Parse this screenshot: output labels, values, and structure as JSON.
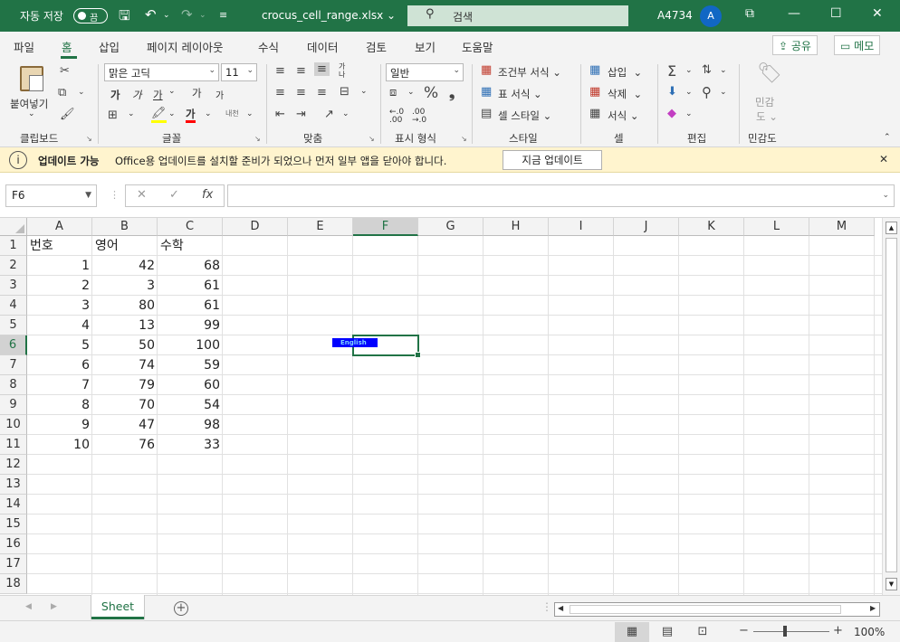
{
  "titlebar": {
    "autosave_label": "자동 저장",
    "autosave_state": "끔",
    "filename": "crocus_cell_range.xlsx",
    "filename_caret": "⌄",
    "search_placeholder": "검색",
    "user": "A4734",
    "avatar_initial": "A"
  },
  "tabs": [
    "파일",
    "홈",
    "삽입",
    "페이지 레이아웃",
    "수식",
    "데이터",
    "검토",
    "보기",
    "도움말"
  ],
  "active_tab": "홈",
  "share_label": "공유",
  "memo_label": "메모",
  "ribbon": {
    "clipboard": {
      "paste": "붙여넣기",
      "label": "클립보드"
    },
    "font": {
      "name": "맑은 고딕",
      "size": "11",
      "label": "글꼴",
      "bold": "가",
      "italic": "가",
      "underline": "가",
      "grow": "가",
      "shrink": "가",
      "phonetic": "내천"
    },
    "align": {
      "label": "맞춤",
      "wrap": "가나"
    },
    "number": {
      "format": "일반",
      "label": "표시 형식"
    },
    "styles": {
      "conditional": "조건부 서식",
      "table": "표 서식",
      "cell": "셀 스타일",
      "label": "스타일"
    },
    "cells": {
      "insert": "삽입",
      "delete": "삭제",
      "format": "서식",
      "label": "셀"
    },
    "editing": {
      "label": "편집"
    },
    "sensitivity": {
      "btn_line1": "민감",
      "btn_line2": "도",
      "label": "민감도"
    }
  },
  "infobar": {
    "title": "업데이트 가능",
    "message": "Office용 업데이트를 설치할 준비가 되었으나 먼저 일부 앱을 닫아야 합니다.",
    "button": "지금 업데이트"
  },
  "formula": {
    "namebox": "F6",
    "value": ""
  },
  "grid": {
    "columns": [
      "A",
      "B",
      "C",
      "D",
      "E",
      "F",
      "G",
      "H",
      "I",
      "J",
      "K",
      "L",
      "M"
    ],
    "selected_column": "F",
    "selected_row": "6",
    "rows": [
      "1",
      "2",
      "3",
      "4",
      "5",
      "6",
      "7",
      "8",
      "9",
      "10",
      "11",
      "12",
      "13",
      "14",
      "15",
      "16",
      "17",
      "18"
    ],
    "header_row": [
      "번호",
      "영어",
      "수학"
    ],
    "data": [
      [
        "1",
        "42",
        "68"
      ],
      [
        "2",
        "3",
        "61"
      ],
      [
        "3",
        "80",
        "61"
      ],
      [
        "4",
        "13",
        "99"
      ],
      [
        "5",
        "50",
        "100"
      ],
      [
        "6",
        "74",
        "59"
      ],
      [
        "7",
        "79",
        "60"
      ],
      [
        "8",
        "70",
        "54"
      ],
      [
        "9",
        "47",
        "98"
      ],
      [
        "10",
        "76",
        "33"
      ]
    ],
    "ime_indicator": "English"
  },
  "sheet_tab": "Sheet",
  "status": {
    "zoom": "100%"
  },
  "colors": {
    "accent": "#217346",
    "infobar": "#fff4ce",
    "ime": "#0000ff"
  }
}
